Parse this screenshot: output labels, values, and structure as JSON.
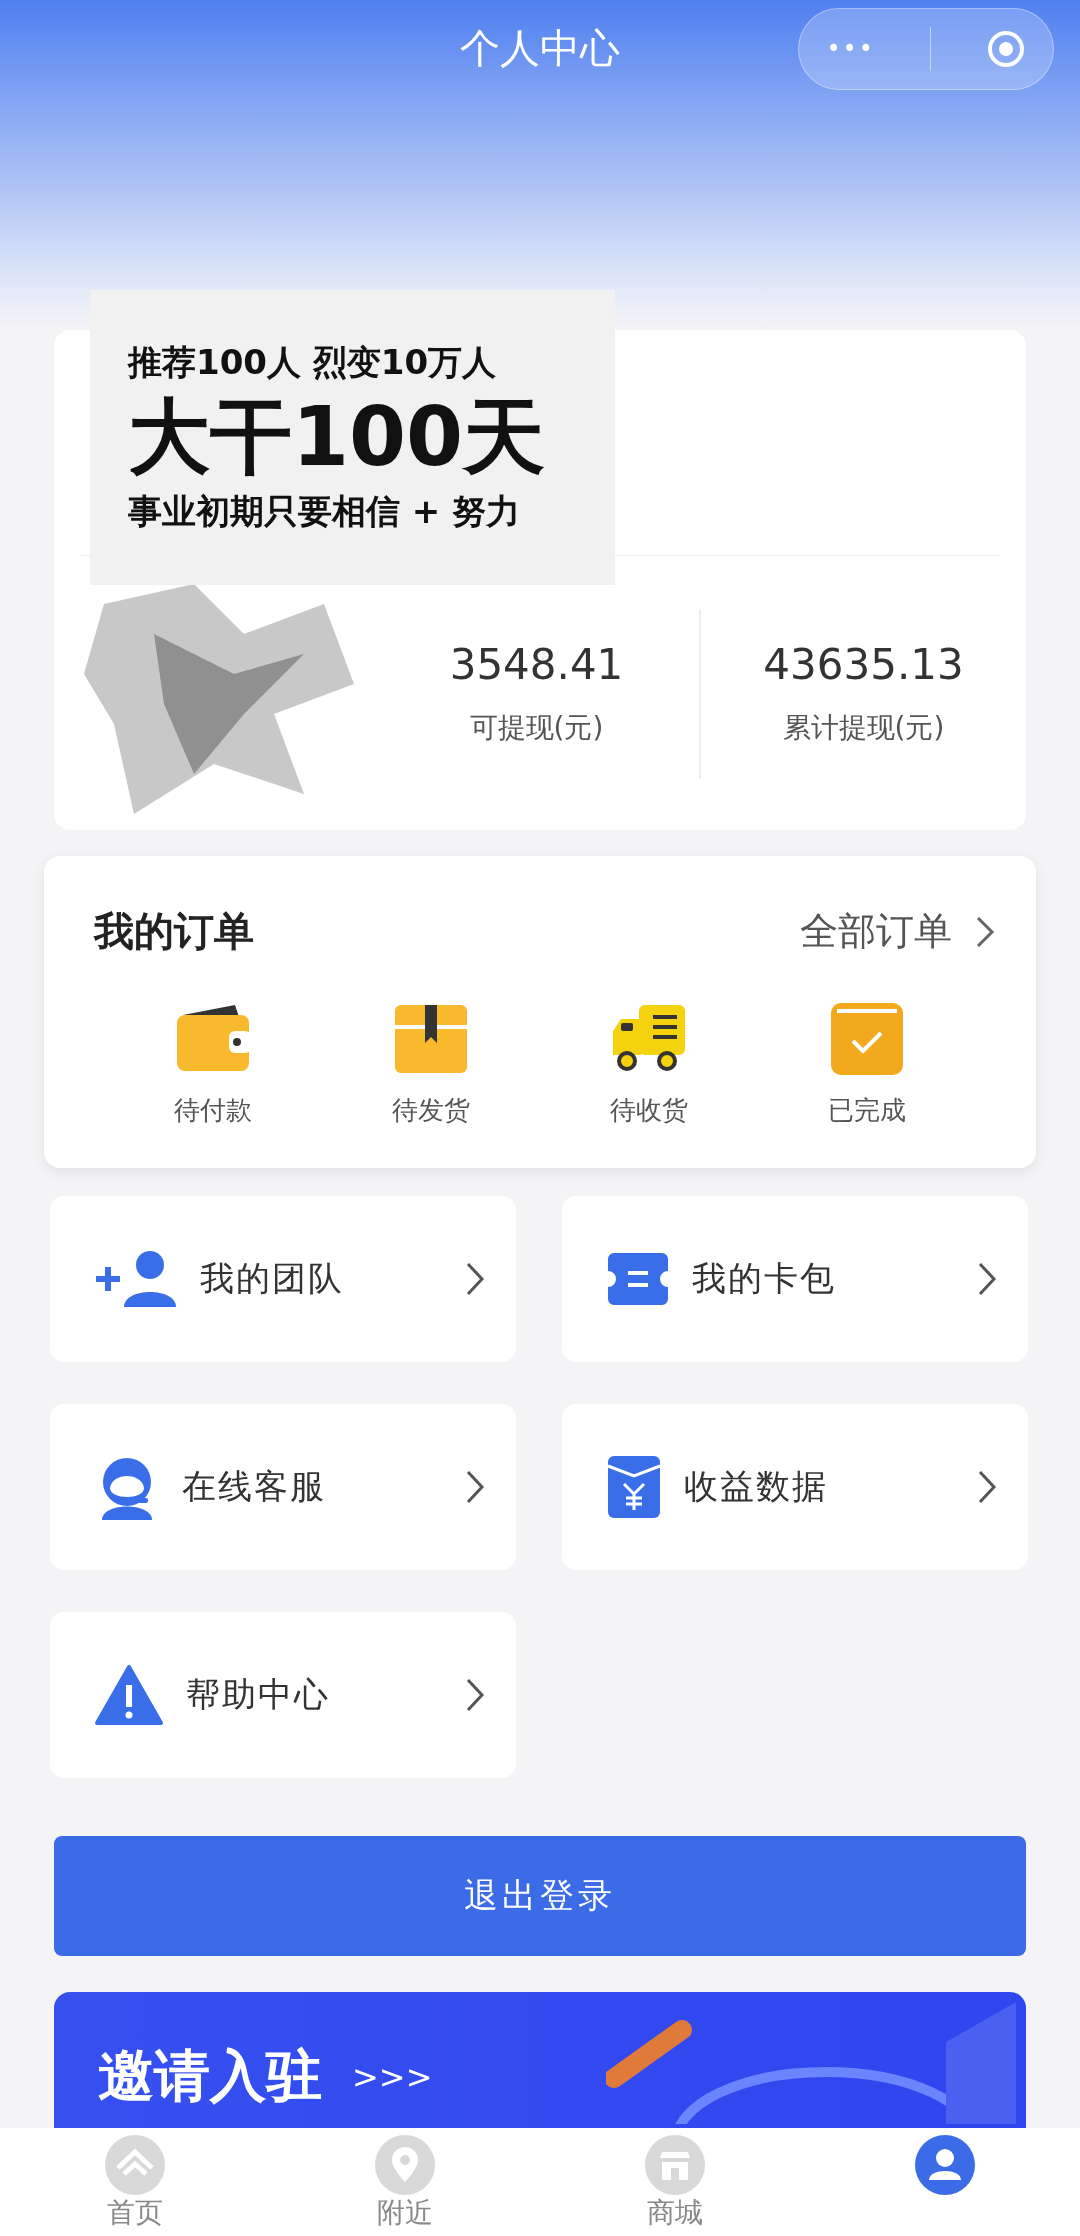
{
  "header": {
    "title": "个人中心",
    "more_button": "•••"
  },
  "promo_overlay": {
    "lines": [
      "推荐100人  烈变10万人",
      "大干100天",
      "事业初期只要相信 + 努力"
    ]
  },
  "account": {
    "stats": [
      {
        "value": "3548.41",
        "label": "可提现(元)"
      },
      {
        "value": "43635.13",
        "label": "累计提现(元)"
      }
    ]
  },
  "orders": {
    "title": "我的订单",
    "all_link": "全部订单",
    "items": [
      {
        "kind": "wallet",
        "label": "待付款"
      },
      {
        "kind": "box",
        "label": "待发货"
      },
      {
        "kind": "truck",
        "label": "待收货"
      },
      {
        "kind": "done",
        "label": "已完成"
      }
    ]
  },
  "menu": [
    {
      "kind": "team",
      "label": "我的团队"
    },
    {
      "kind": "card",
      "label": "我的卡包"
    },
    {
      "kind": "service",
      "label": "在线客服"
    },
    {
      "kind": "income",
      "label": "收益数据"
    },
    {
      "kind": "help",
      "label": "帮助中心"
    }
  ],
  "logout_button": "退出登录",
  "invite_banner": {
    "title": "邀请入驻",
    "arrows": ">>>"
  },
  "tab_bar": [
    {
      "kind": "home",
      "label": "首页",
      "selected": false
    },
    {
      "kind": "nearby",
      "label": "附近",
      "selected": false
    },
    {
      "kind": "shop",
      "label": "商城",
      "selected": false
    },
    {
      "kind": "me",
      "selected": true
    }
  ]
}
